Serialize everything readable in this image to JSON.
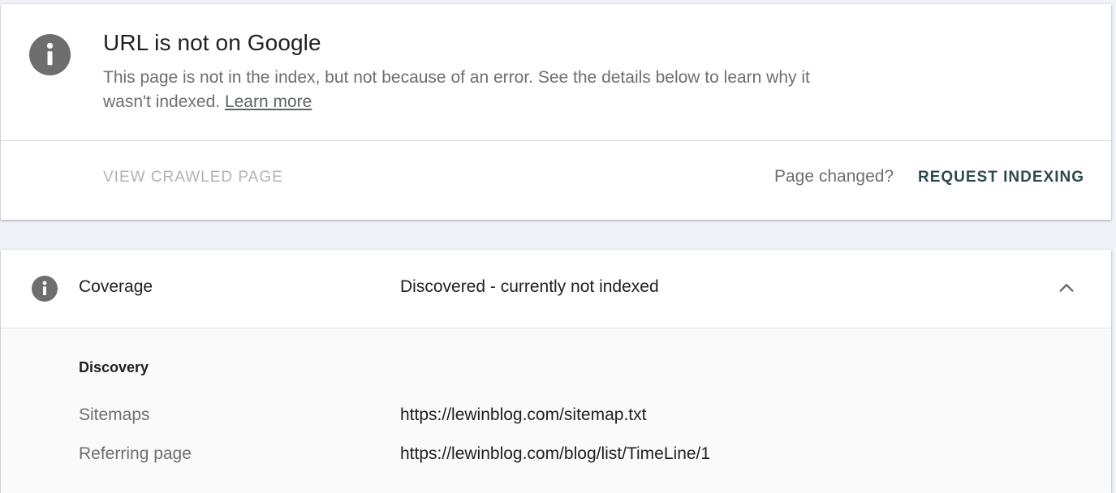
{
  "status": {
    "title": "URL is not on Google",
    "description": "This page is not in the index, but not because of an error. See the details below to learn why it wasn't indexed.",
    "learn_more": "Learn more",
    "view_crawled_label": "VIEW CRAWLED PAGE",
    "page_changed": "Page changed?",
    "request_indexing_label": "REQUEST INDEXING",
    "icon": "info-icon"
  },
  "coverage": {
    "label": "Coverage",
    "value": "Discovered - currently not indexed",
    "icon": "info-icon",
    "toggle_icon": "chevron-up-icon",
    "discovery": {
      "title": "Discovery",
      "rows": [
        {
          "label": "Sitemaps",
          "value": "https://lewinblog.com/sitemap.txt"
        },
        {
          "label": "Referring page",
          "value": "https://lewinblog.com/blog/list/TimeLine/1"
        }
      ]
    }
  },
  "colors": {
    "icon_gray": "#5f6368",
    "accent": "#2e4a4c",
    "disabled": "#b0b3b7",
    "background": "#f1f3f9"
  }
}
